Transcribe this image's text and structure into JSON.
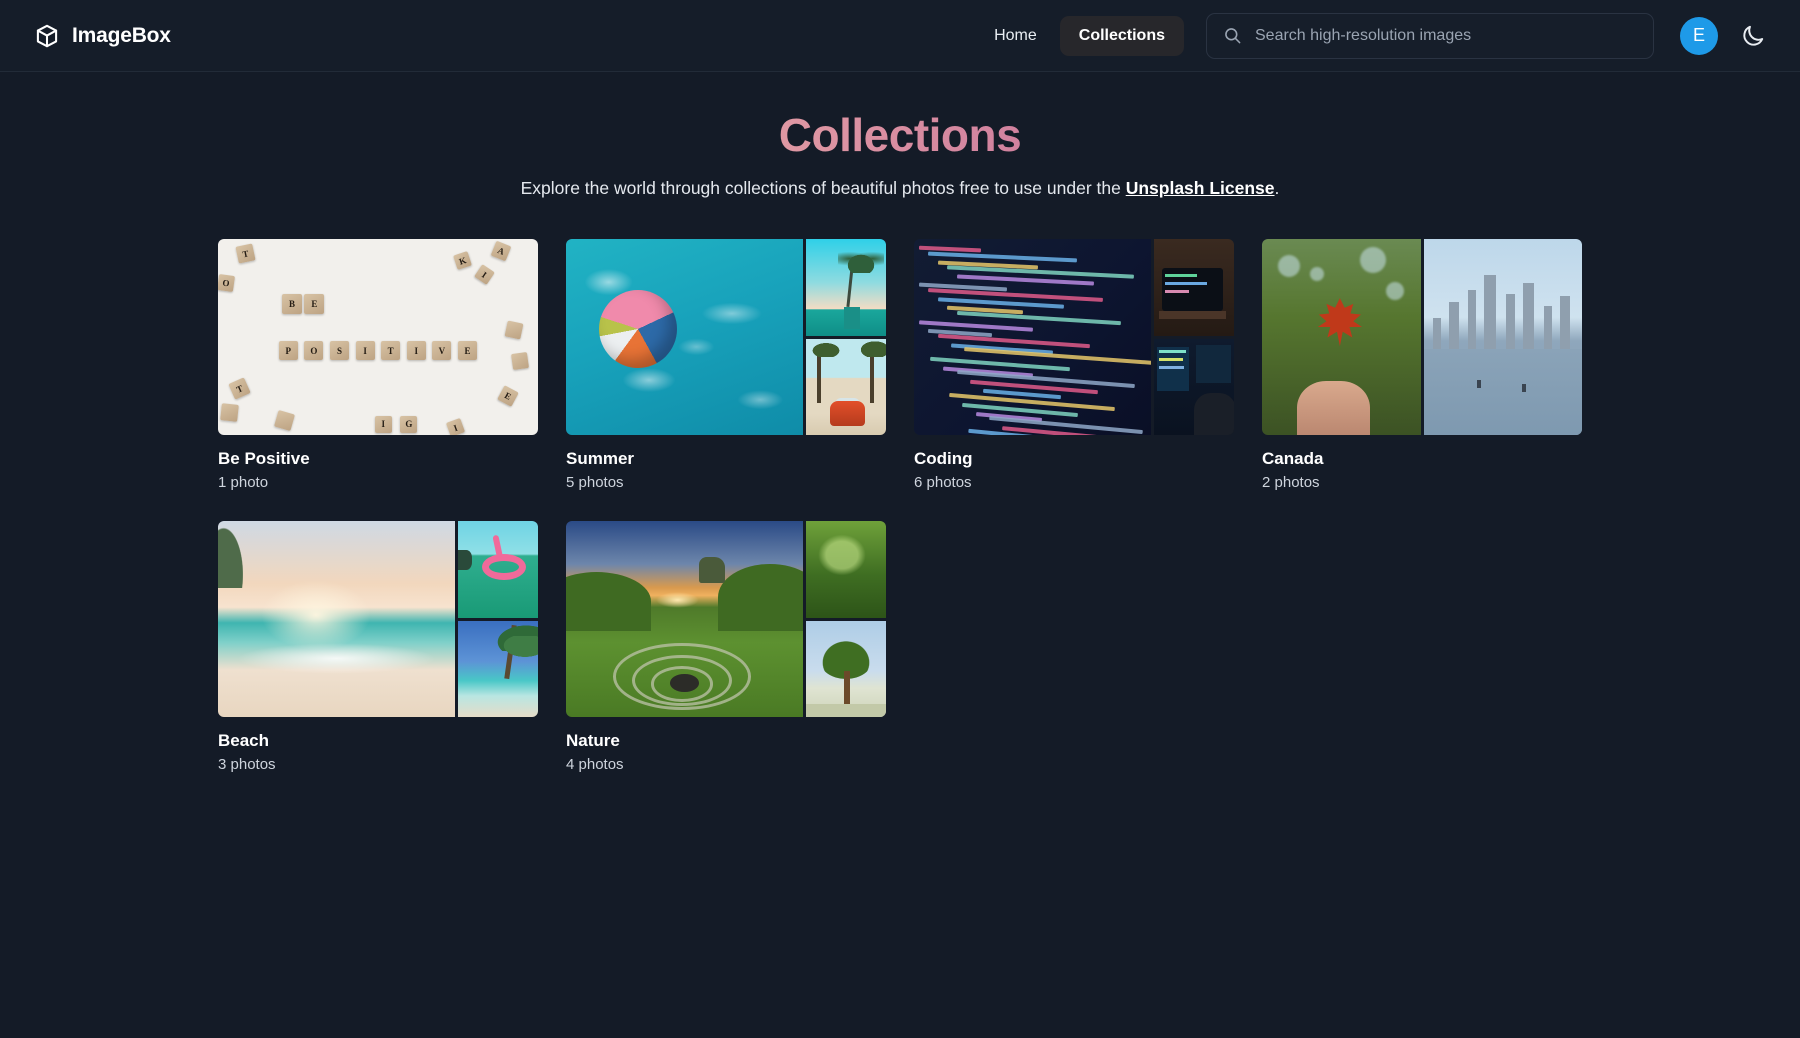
{
  "header": {
    "brand_name": "ImageBox",
    "brand_icon": "cube-icon",
    "nav": [
      {
        "label": "Home",
        "active": false
      },
      {
        "label": "Collections",
        "active": true
      }
    ],
    "search": {
      "placeholder": "Search high-resolution images",
      "value": "",
      "icon": "search-icon"
    },
    "avatar_initial": "E",
    "theme_toggle_icon": "moon-icon",
    "accent_color": "#1e9ae8"
  },
  "page": {
    "title": "Collections",
    "title_gradient_start": "#f2c69d",
    "title_gradient_end": "#a43e7c",
    "subtitle_part1": "Explore the world through collections of beautiful photos free to use under the ",
    "subtitle_link": "Unsplash License",
    "subtitle_part2": "."
  },
  "collections": [
    {
      "title": "Be Positive",
      "count": "1 photo",
      "layout": "single"
    },
    {
      "title": "Summer",
      "count": "5 photos",
      "layout": "main-plus-two"
    },
    {
      "title": "Coding",
      "count": "6 photos",
      "layout": "main-plus-two"
    },
    {
      "title": "Canada",
      "count": "2 photos",
      "layout": "halves"
    },
    {
      "title": "Beach",
      "count": "3 photos",
      "layout": "main-plus-two"
    },
    {
      "title": "Nature",
      "count": "4 photos",
      "layout": "main-plus-two"
    }
  ]
}
